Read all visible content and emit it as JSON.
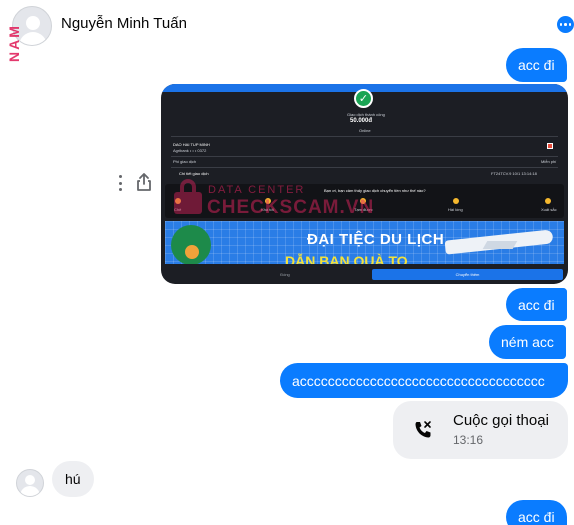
{
  "header": {
    "contact_name": "Nguyễn Minh Tuấn",
    "side_mark": "NAM"
  },
  "messages": {
    "m1": "acc đi",
    "m2": "acc đi",
    "m3": "ném acc",
    "m4": "accccccccccccccccccccccccccccccccccc",
    "m5_in": "hú",
    "m6": "acc đi"
  },
  "call": {
    "title": "Cuộc gọi thoại",
    "time": "13:16"
  },
  "image": {
    "status": "Giao dịch thành công",
    "amount": "50.000đ",
    "amount_sub": "Online",
    "recipient": "DAO HAI TUP MINH",
    "recipient_acct": "Agribank • • • 0372",
    "fee_label": "Phí giao dịch",
    "fee_value": "Miễn phí",
    "row_label": "Chi tiết giao dịch",
    "row_value": "FT24TCV.9 10/1 13:14:18",
    "question": "Bạn ơi, bạn cảm thấy giao dịch chuyển tiền như thế nào?",
    "ratings": [
      "Chê",
      "Khá tốt",
      "Tạm được",
      "Hài lòng",
      "Xuất sắc"
    ],
    "banner_title": "ĐẠI TIỆC DU LỊCH",
    "banner_sub": "DẪN BẠN QUÀ TO",
    "btn_left": "Đóng",
    "btn_right": "Chuyển thêm",
    "watermark_small": "DATA CENTER",
    "watermark_big": "CHECKSCAM.VN"
  },
  "colors": {
    "outgoing": "#0a7cff",
    "incoming": "#eeeff2",
    "watermark": "#e0245e"
  },
  "icons": [
    "more-icon",
    "vertical-dots-icon",
    "share-icon",
    "missed-call-icon"
  ]
}
